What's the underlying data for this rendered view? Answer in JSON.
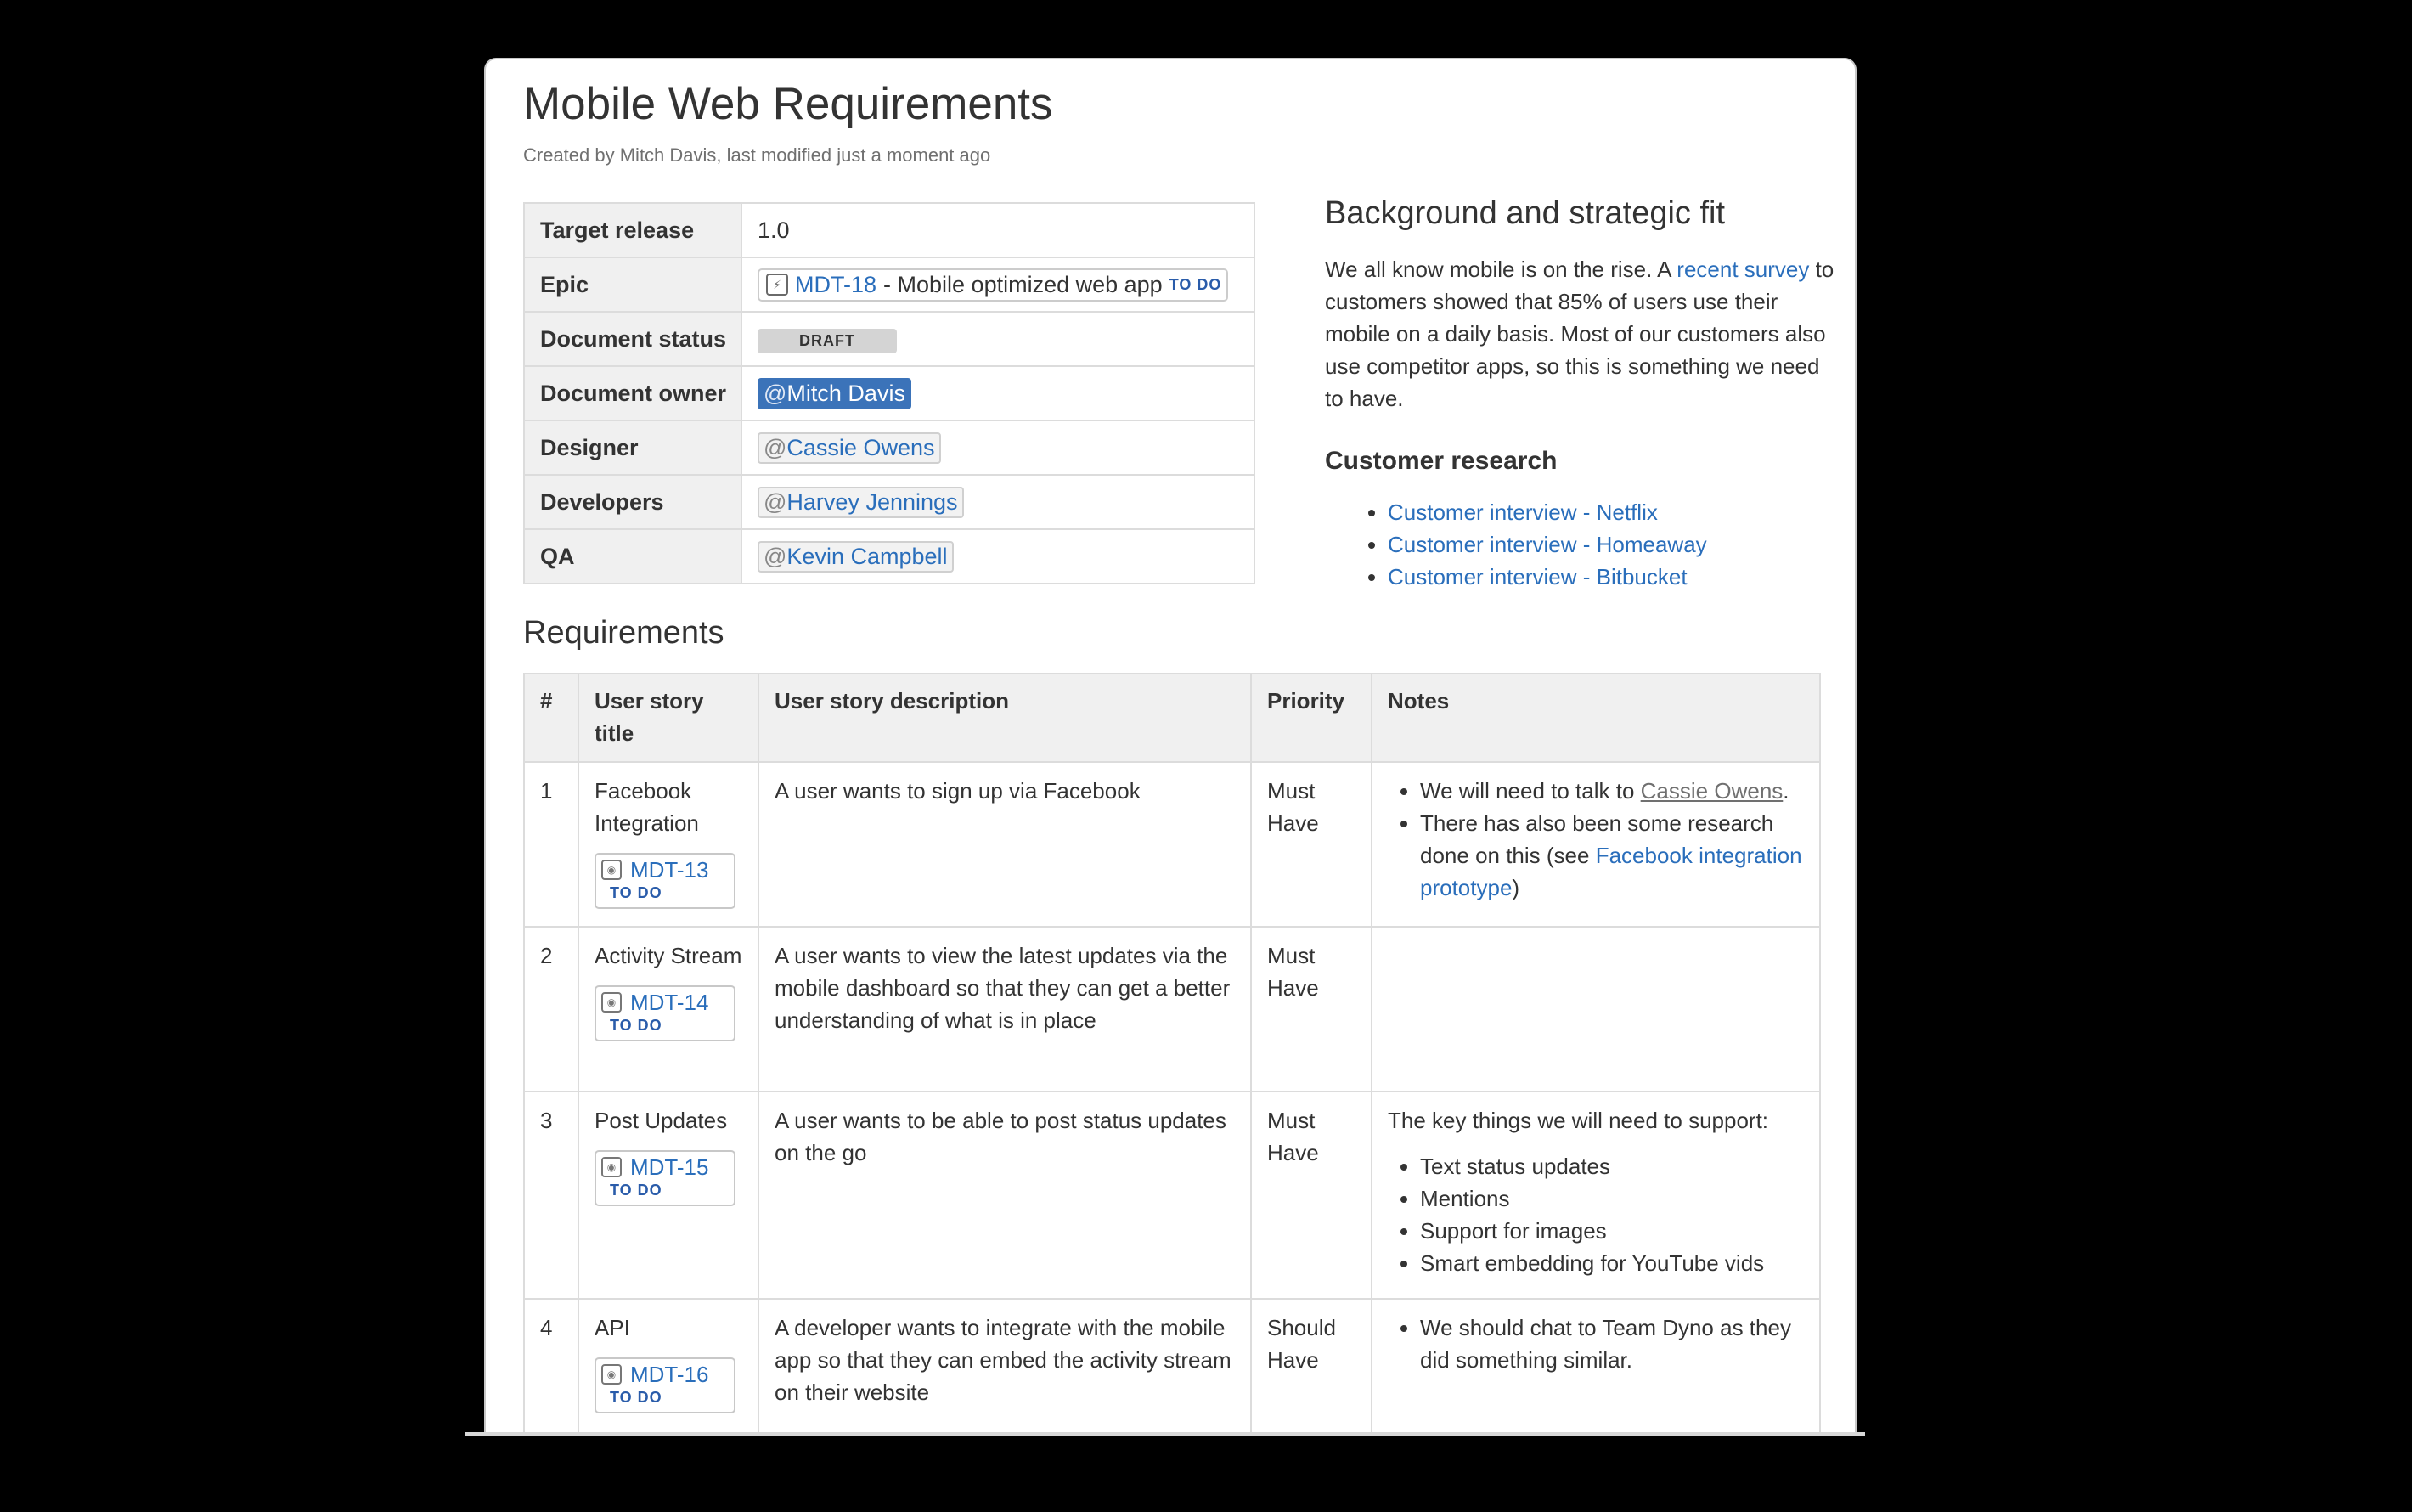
{
  "page": {
    "title": "Mobile Web Requirements",
    "byline": "Created by Mitch Davis, last modified just a moment ago"
  },
  "properties": {
    "target_release": {
      "label": "Target release",
      "value": "1.0"
    },
    "epic": {
      "label": "Epic",
      "key": "MDT-18",
      "summary": "- Mobile optimized web app",
      "status": "TO DO"
    },
    "document_status": {
      "label": "Document status",
      "value": "DRAFT"
    },
    "document_owner": {
      "label": "Document owner",
      "value": "Mitch Davis"
    },
    "designer": {
      "label": "Designer",
      "value": "Cassie Owens"
    },
    "developers": {
      "label": "Developers",
      "value": "Harvey Jennings"
    },
    "qa": {
      "label": "QA",
      "value": "Kevin Campbell"
    }
  },
  "background": {
    "heading": "Background and strategic fit",
    "text_before": "We all know mobile is on the rise. A ",
    "link": "recent survey",
    "text_after": " to customers showed that 85% of users use their mobile on a daily basis. Most of our customers also use competitor apps, so this is something we need to have."
  },
  "customer_research": {
    "heading": "Customer research",
    "items": [
      "Customer interview - Netflix",
      "Customer interview - Homeaway",
      "Customer interview - Bitbucket"
    ]
  },
  "requirements": {
    "heading": "Requirements",
    "columns": [
      "#",
      "User story title",
      "User story description",
      "Priority",
      "Notes"
    ],
    "rows": [
      {
        "num": "1",
        "title": "Facebook Integration",
        "issue": "MDT-13",
        "status": "TO DO",
        "description": "A user wants to sign up via Facebook",
        "priority": "Must Have",
        "notes": {
          "b1_prefix": "We will need to talk to ",
          "b1_link": "Cassie Owens",
          "b1_suffix": ".",
          "b2_prefix": "There has also been some research done on this (see ",
          "b2_link": "Facebook integration prototype",
          "b2_suffix": ")"
        }
      },
      {
        "num": "2",
        "title": "Activity Stream",
        "issue": "MDT-14",
        "status": "TO DO",
        "description": "A user wants to view the latest updates via the mobile dashboard so that they can get a better understanding of what is in place",
        "priority": "Must Have"
      },
      {
        "num": "3",
        "title": "Post Updates",
        "issue": "MDT-15",
        "status": "TO DO",
        "description": "A user wants to be able to post status updates on the go",
        "priority": "Must Have",
        "notes": {
          "intro": "The key things we will need to support:",
          "items": [
            "Text status updates",
            "Mentions",
            "Support for images",
            "Smart embedding for YouTube vids"
          ]
        }
      },
      {
        "num": "4",
        "title": "API",
        "issue": "MDT-16",
        "status": "TO DO",
        "description": "A developer wants to integrate with the mobile app so that they can embed the activity stream on their website",
        "priority": "Should Have",
        "notes": {
          "items": [
            "We should chat to Team Dyno as they did something similar."
          ]
        }
      }
    ]
  }
}
